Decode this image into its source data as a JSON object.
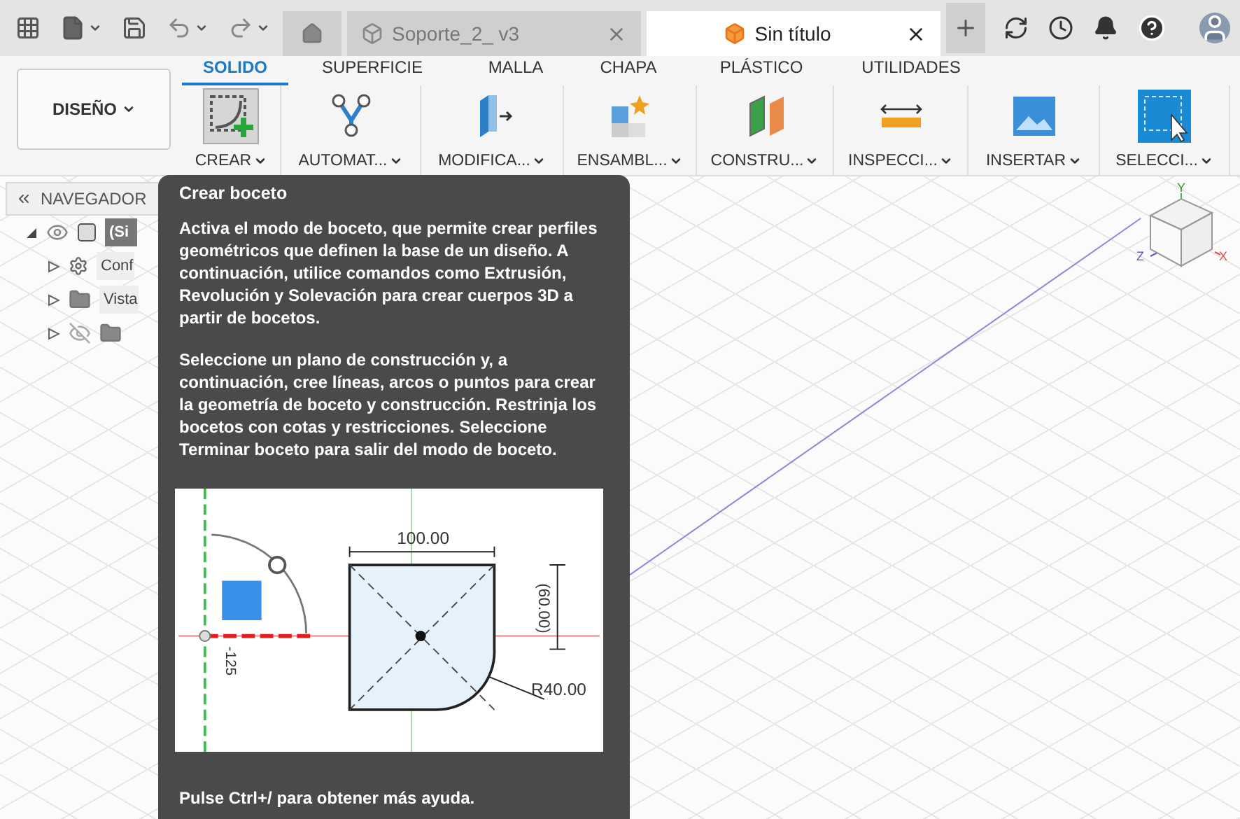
{
  "doc_tabs": [
    {
      "kind": "home",
      "selected": false
    },
    {
      "kind": "doc",
      "label": "Soporte_2_ v3",
      "selected": false
    },
    {
      "kind": "doc",
      "label": "Sin título",
      "selected": true
    }
  ],
  "ribbon": {
    "workspace": "DISEÑO",
    "tabs": [
      {
        "label": "SOLIDO",
        "selected": true
      },
      {
        "label": "SUPERFICIE",
        "selected": false
      },
      {
        "label": "MALLA",
        "selected": false
      },
      {
        "label": "CHAPA",
        "selected": false
      },
      {
        "label": "PLÁSTICO",
        "selected": false
      },
      {
        "label": "UTILIDADES",
        "selected": false
      }
    ],
    "tools": [
      {
        "label": "CREAR",
        "kind": "sketch",
        "selected": true
      },
      {
        "label": "AUTOMAT...",
        "kind": "automate",
        "selected": false
      },
      {
        "label": "MODIFICA...",
        "kind": "modify",
        "selected": false
      },
      {
        "label": "ENSAMBL...",
        "kind": "assemble",
        "selected": false
      },
      {
        "label": "CONSTRU...",
        "kind": "construct",
        "selected": false
      },
      {
        "label": "INSPECCI...",
        "kind": "inspect",
        "selected": false
      },
      {
        "label": "INSERTAR",
        "kind": "insert",
        "selected": false
      },
      {
        "label": "SELECCI...",
        "kind": "select",
        "selected": false
      }
    ]
  },
  "navigator": {
    "title": "NAVEGADOR",
    "items": [
      {
        "label": "(Si",
        "kind": "component",
        "hidden": false,
        "expanded": true,
        "children": [
          {
            "label": "Conf",
            "kind": "settings",
            "hidden": false,
            "expanded": false
          },
          {
            "label": "Vista",
            "kind": "folder",
            "hidden": false,
            "expanded": false
          },
          {
            "kind": "folder",
            "hidden": true,
            "expanded": false
          }
        ]
      }
    ]
  },
  "tooltip": {
    "title": "Crear boceto",
    "paragraphs": [
      "Activa el modo de boceto, que permite crear perfiles geométricos que definen la base de un diseño. A continuación, utilice comandos como Extrusión, Revolución y Solevación para crear cuerpos 3D a partir de bocetos.",
      "Seleccione un plano de construcción y, a continuación, cree líneas, arcos o puntos para crear la geometría de boceto y construcción. Restrinja los bocetos con cotas y restricciones. Seleccione Terminar boceto para salir del modo de boceto."
    ],
    "diagram_labels": [
      "100.00",
      "(60.00)",
      "R40.00",
      "-125"
    ],
    "footer": "Pulse Ctrl+/ para obtener más ayuda."
  },
  "viewcube": {
    "axes": [
      "Y",
      "Z",
      "X"
    ]
  }
}
